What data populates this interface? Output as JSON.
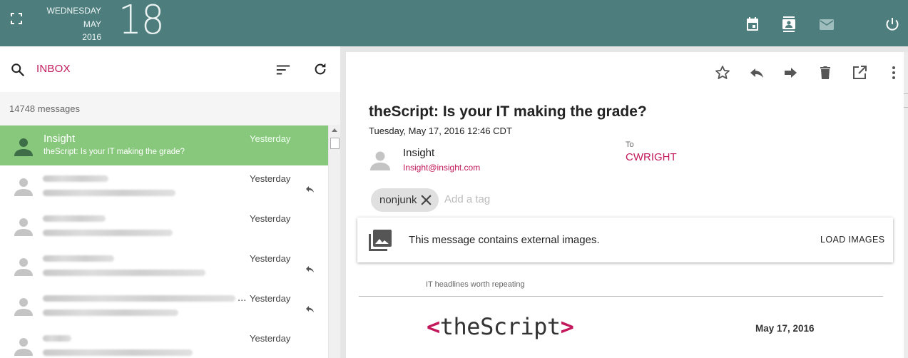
{
  "header": {
    "weekday": "WEDNESDAY",
    "month": "MAY",
    "year": "2016",
    "day": "18",
    "icons": [
      "fullscreen-icon",
      "calendar-icon",
      "contacts-icon",
      "mail-icon",
      "power-icon"
    ]
  },
  "mailbox": {
    "folder": "INBOX",
    "count_text": "14748 messages"
  },
  "messages": [
    {
      "sender": "Insight",
      "subject": "theScript: Is your IT making the grade?",
      "when": "Yesterday",
      "selected": true,
      "replied": false
    },
    {
      "sender": "",
      "subject": "",
      "when": "Yesterday",
      "selected": false,
      "replied": true
    },
    {
      "sender": "",
      "subject": "",
      "when": "Yesterday",
      "selected": false,
      "replied": false
    },
    {
      "sender": "",
      "subject": "",
      "when": "Yesterday",
      "selected": false,
      "replied": true
    },
    {
      "sender": "",
      "subject": "",
      "when": "Yesterday",
      "selected": false,
      "replied": true,
      "truncated": "..."
    },
    {
      "sender": "",
      "subject": "",
      "when": "Yesterday",
      "selected": false,
      "replied": false
    }
  ],
  "email": {
    "subject": "theScript: Is your IT making the grade?",
    "date": "Tuesday, May 17, 2016 12:46 CDT",
    "from_name": "Insight",
    "from_email": "Insight@insight.com",
    "to_label": "To",
    "to_value": "CWRIGHT",
    "tag": "nonjunk",
    "tag_placeholder": "Add a tag",
    "external_notice": "This message contains external images.",
    "load_images_label": "LOAD IMAGES",
    "preheader": "IT headlines worth repeating",
    "logo_open": "<",
    "logo_text": "theScript",
    "logo_close": ">",
    "newsletter_date": "May 17, 2016"
  },
  "colors": {
    "header_bg": "#4d7e7d",
    "accent": "#c2185b",
    "selected_row": "#88c87c"
  }
}
